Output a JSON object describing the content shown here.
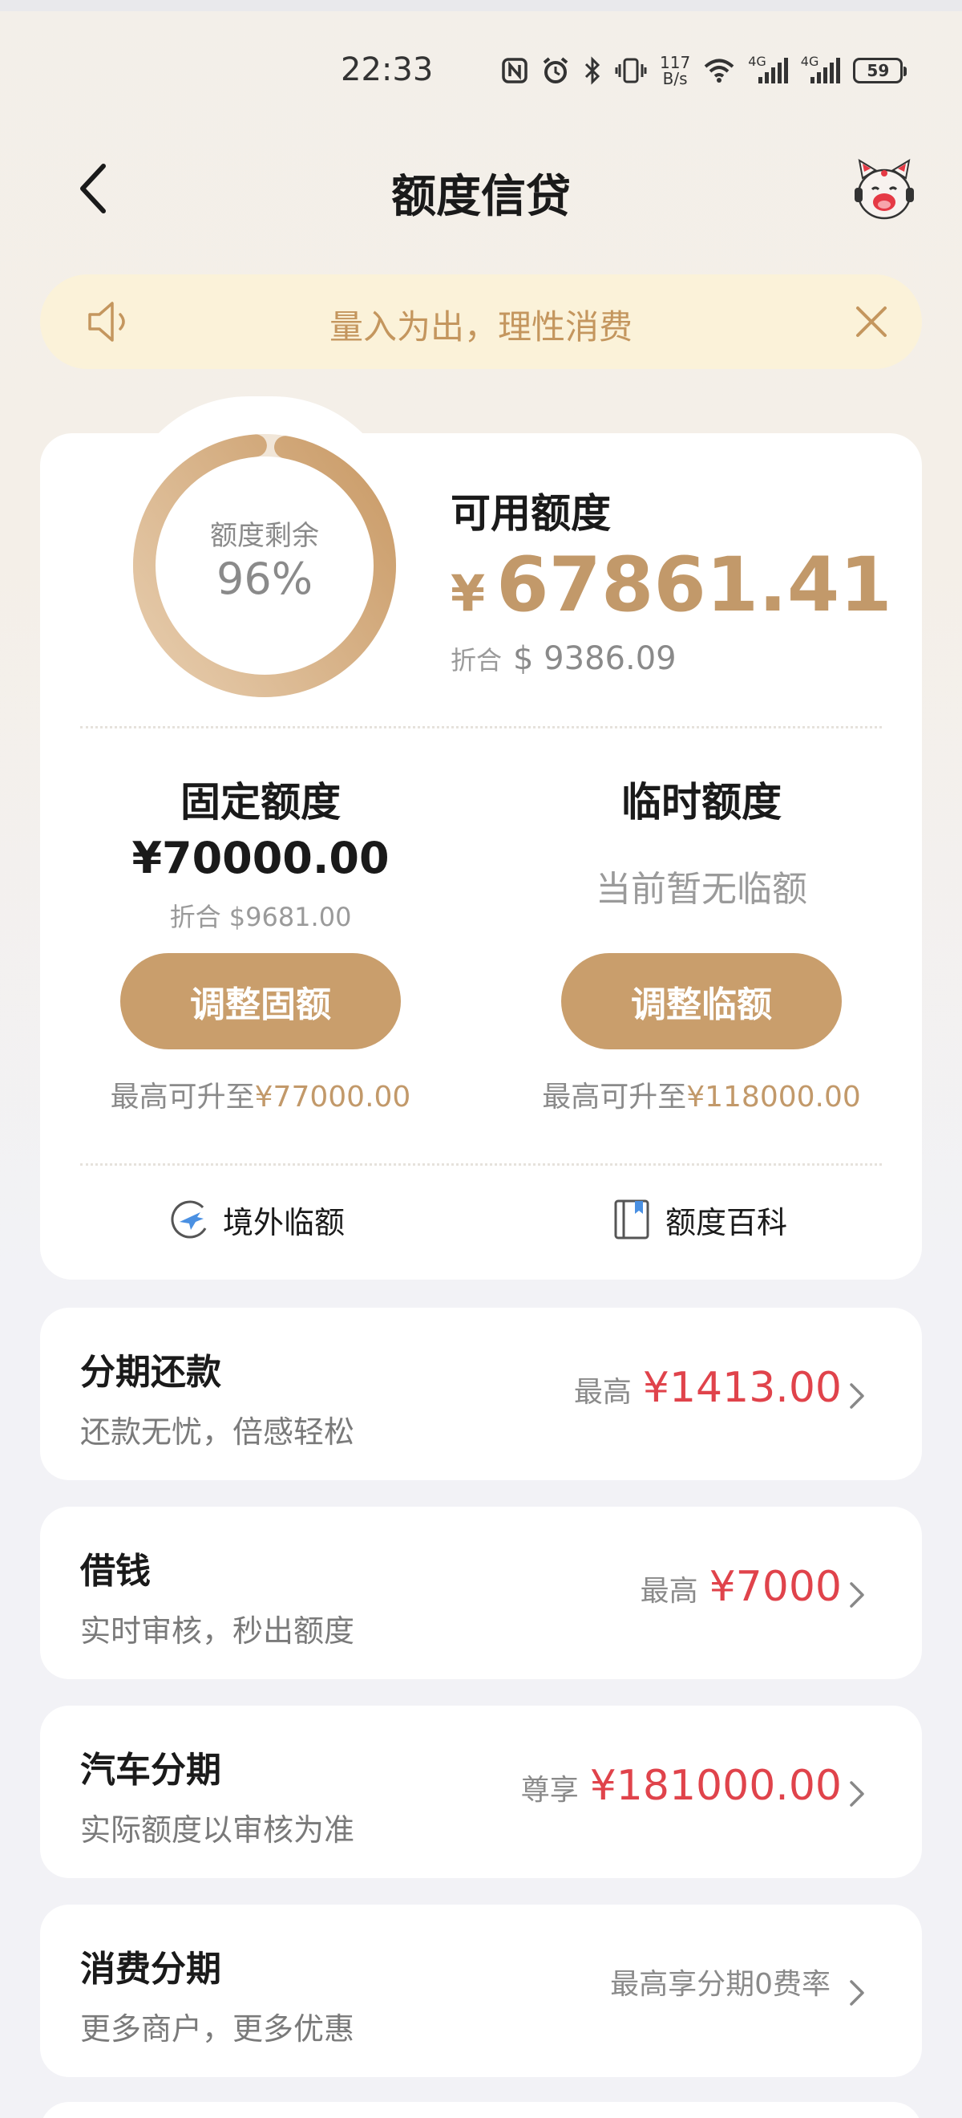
{
  "status_bar": {
    "time": "22:33",
    "speed_value": "117",
    "speed_unit": "B/s",
    "net1": "4G",
    "net2": "4G",
    "battery": "59",
    "icons": [
      "nfc-icon",
      "alarm-icon",
      "bluetooth-icon",
      "vibrate-icon",
      "wifi-icon",
      "signal-icon",
      "battery-icon"
    ]
  },
  "header": {
    "title": "额度信贷",
    "back_icon": "chevron-left-icon",
    "assistant_icon": "mascot-icon"
  },
  "notice": {
    "text": "量入为出，理性消费",
    "icon": "speaker-icon",
    "close_icon": "close-icon"
  },
  "credit": {
    "remaining_label": "额度剩余",
    "remaining_percent": "96%",
    "remaining_fraction": 0.96,
    "available_label": "可用额度",
    "currency_symbol": "¥",
    "available_amount": "67861.41",
    "usd_label": "折合",
    "usd_amount": "$ 9386.09",
    "fixed": {
      "title": "固定额度",
      "amount": "¥70000.00",
      "usd": "折合 $9681.00",
      "button": "调整固额",
      "max_prefix": "最高可升至",
      "max_amount": "¥77000.00"
    },
    "temporary": {
      "title": "临时额度",
      "status": "当前暂无临额",
      "button": "调整临额",
      "max_prefix": "最高可升至",
      "max_amount": "¥118000.00"
    },
    "links": [
      {
        "label": "境外临额",
        "icon": "plane-globe-icon"
      },
      {
        "label": "额度百科",
        "icon": "book-icon"
      }
    ]
  },
  "products": [
    {
      "title": "分期还款",
      "subtitle": "还款无忧，倍感轻松",
      "prefix": "最高",
      "amount": "¥1413.00"
    },
    {
      "title": "借钱",
      "subtitle": "实时审核，秒出额度",
      "prefix": "最高",
      "amount": "¥7000"
    },
    {
      "title": "汽车分期",
      "subtitle": "实际额度以审核为准",
      "prefix": "尊享",
      "amount": "¥181000.00"
    },
    {
      "title": "消费分期",
      "subtitle": "更多商户，更多优惠",
      "prefix": "最高享分期0费率",
      "amount": ""
    }
  ],
  "colors": {
    "gold": "#c2996a",
    "button_gold": "#c99e6c",
    "red": "#e0434b",
    "notice_bg": "#fbf2d9"
  }
}
